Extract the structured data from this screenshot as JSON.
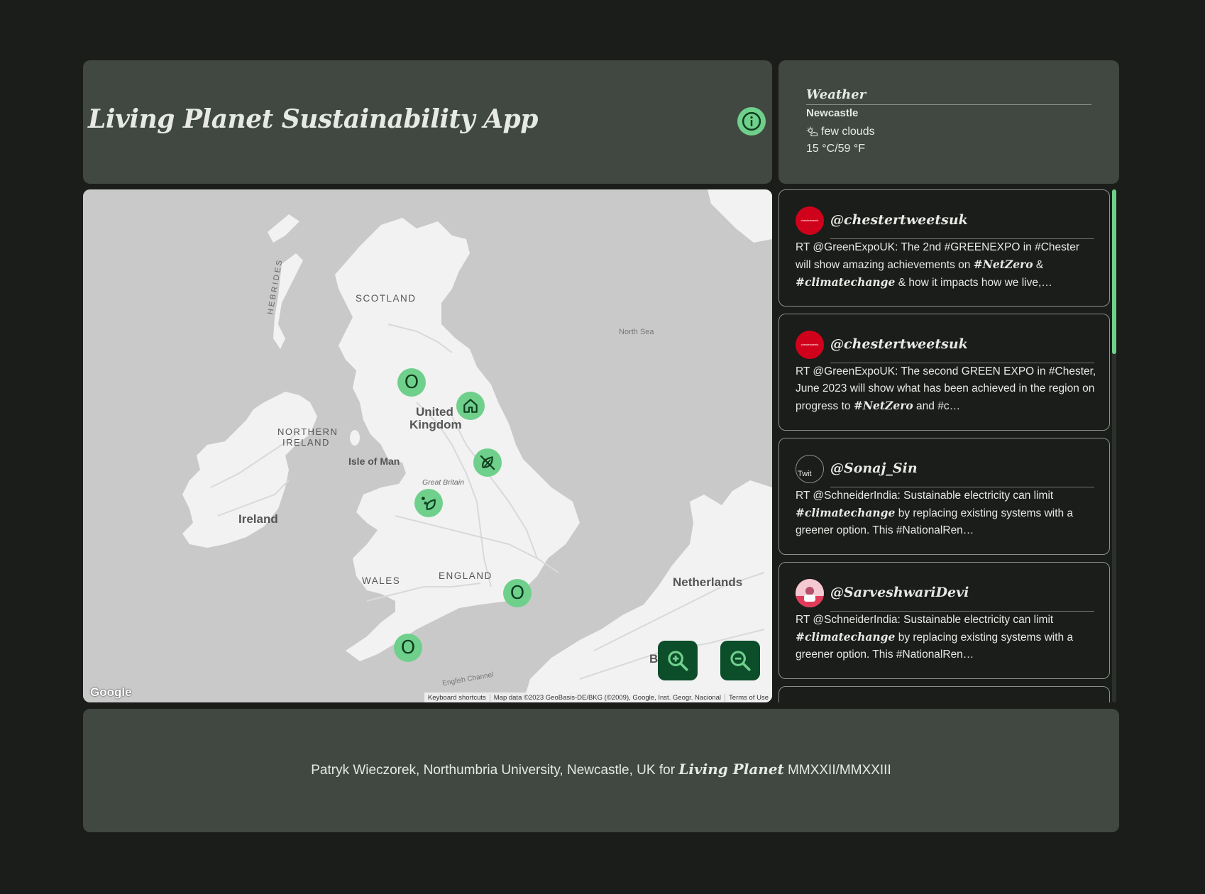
{
  "header": {
    "title": "Living Planet Sustainability App",
    "info_icon": "info-icon"
  },
  "weather": {
    "title": "Weather",
    "city": "Newcastle",
    "condition": "few clouds",
    "condition_icon": "cloud-sun-icon",
    "temperature": "15 °C/59 °F"
  },
  "map": {
    "labels": {
      "scotland": "SCOTLAND",
      "hebrides": "HEBRIDES",
      "north_sea": "North Sea",
      "northern_ireland_1": "NORTHERN",
      "northern_ireland_2": "IRELAND",
      "united_kingdom_1": "United",
      "united_kingdom_2": "Kingdom",
      "isle_of_man": "Isle of Man",
      "great_britain": "Great Britain",
      "ireland": "Ireland",
      "wales": "WALES",
      "england": "ENGLAND",
      "netherlands": "Netherlands",
      "english_channel": "English Channel",
      "belgium_partial": "B"
    },
    "markers": [
      {
        "name": "marker-scotland-border",
        "glyph": "O"
      },
      {
        "name": "marker-newcastle-home",
        "icon": "home-icon"
      },
      {
        "name": "marker-no-leaf",
        "icon": "crossed-leaf-icon"
      },
      {
        "name": "marker-eco",
        "icon": "eco-leaf-icon"
      },
      {
        "name": "marker-london",
        "glyph": "O"
      },
      {
        "name": "marker-cornwall",
        "glyph": "O"
      }
    ],
    "zoom_in_icon": "zoom-in-icon",
    "zoom_out_icon": "zoom-out-icon",
    "google_logo": "Google",
    "attribution": {
      "shortcuts": "Keyboard shortcuts",
      "data": "Map data ©2023 GeoBasis-DE/BKG (©2009), Google, Inst. Geogr. Nacional",
      "terms": "Terms of Use"
    }
  },
  "tweets": [
    {
      "handle": "@chestertweetsuk",
      "avatar_color": "#d0021b",
      "avatar_text": "chestertweets",
      "text_parts": [
        "RT @GreenExpoUK: The 2nd #GREENEXPO in #Chester will show amazing achievements on ",
        "#NetZero",
        " & ",
        "#climatechange",
        " & how it impacts how we live,…"
      ]
    },
    {
      "handle": "@chestertweetsuk",
      "avatar_color": "#d0021b",
      "avatar_text": "chestertweets",
      "text_parts": [
        "RT @GreenExpoUK: The second GREEN EXPO in #Chester, June 2023 will show what has been achieved in the region on progress to ",
        "#NetZero",
        " and #c…"
      ]
    },
    {
      "handle": "@Sonaj_Sin",
      "avatar_color": "#1a1d1a",
      "avatar_text": "Twit",
      "text_parts": [
        "RT @SchneiderIndia: Sustainable electricity can limit ",
        "#climatechange",
        " by replacing existing systems with a greener option. This #NationalRen…"
      ]
    },
    {
      "handle": "@SarveshwariDevi",
      "avatar_color": "#e23b5a",
      "avatar_text": "",
      "text_parts": [
        "RT @SchneiderIndia: Sustainable electricity can limit ",
        "#climatechange",
        " by replacing existing systems with a greener option. This #NationalRen…"
      ]
    }
  ],
  "footer": {
    "prefix": "Patryk Wieczorek, Northumbria University, Newcastle, UK for ",
    "emphasis": "Living Planet",
    "suffix": " MMXXII/MMXXIII"
  },
  "colors": {
    "background": "#1a1d1a",
    "panel": "#414841",
    "accent": "#6fd08c",
    "zoom_button": "#0c4d2a"
  }
}
